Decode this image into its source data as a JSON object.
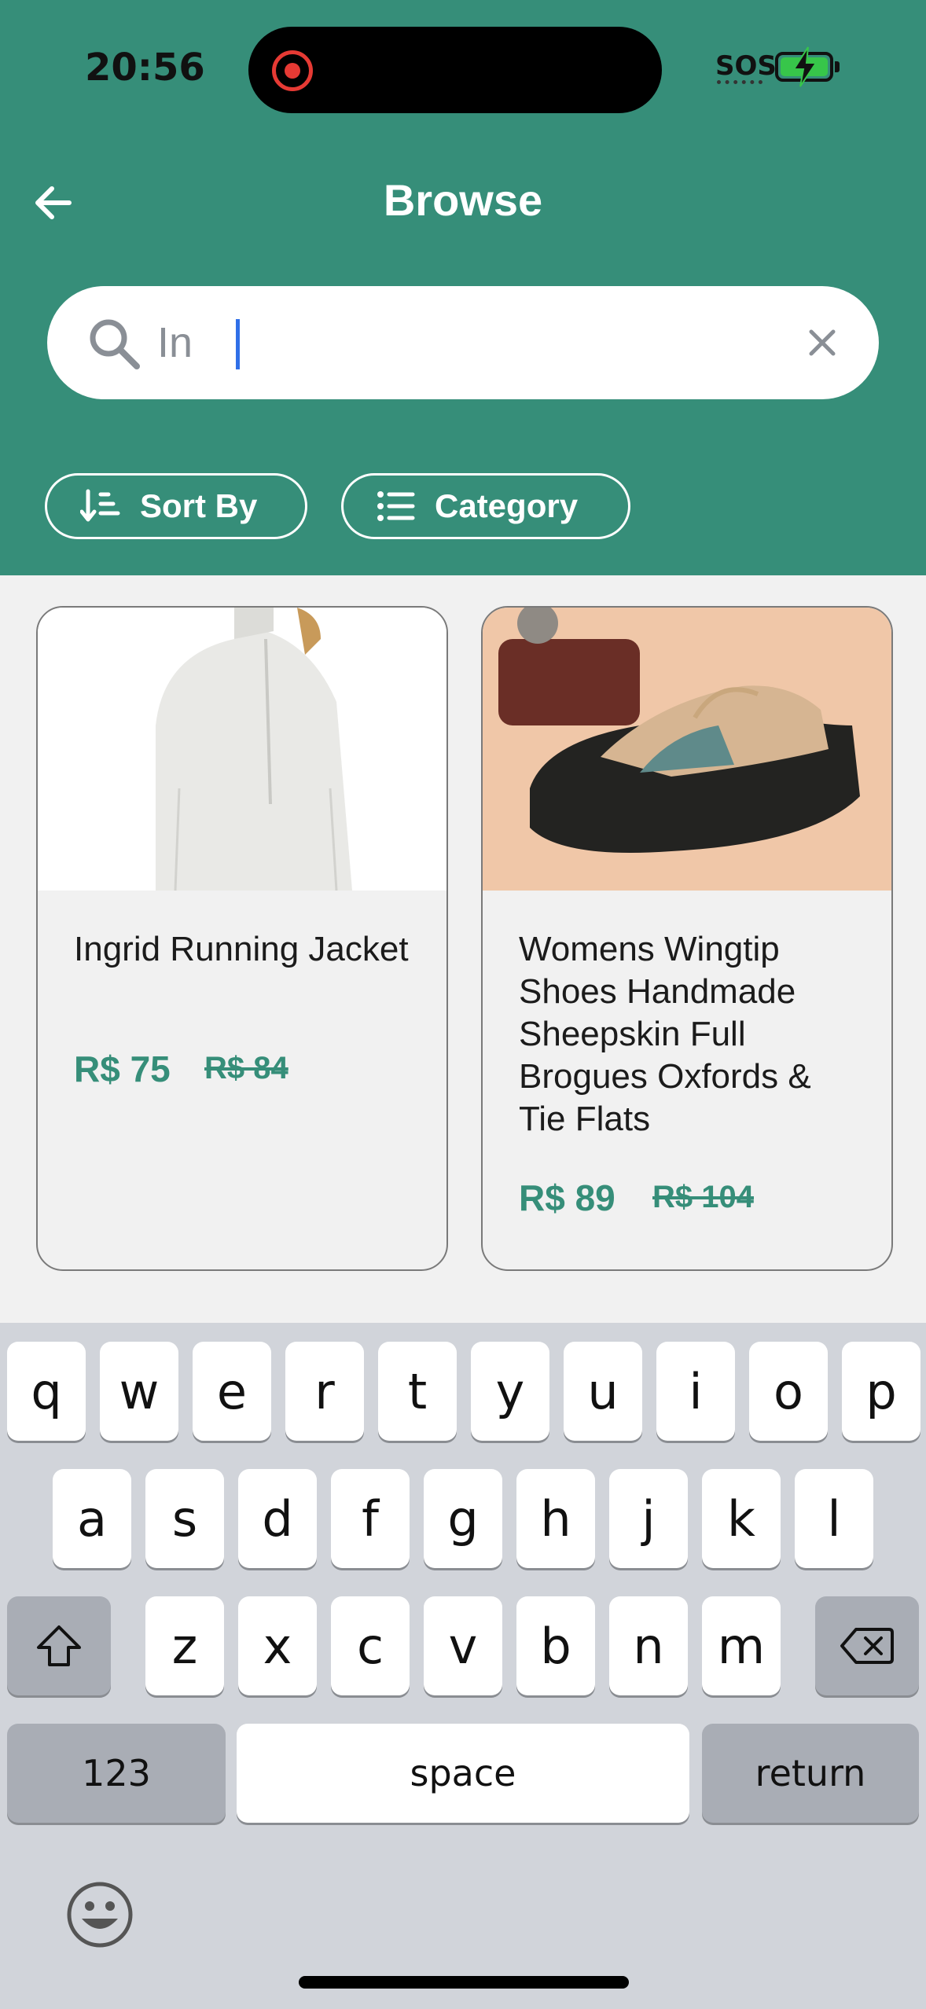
{
  "status_bar": {
    "time": "20:56",
    "sos": "SOS"
  },
  "header": {
    "title": "Browse"
  },
  "search": {
    "value": "In"
  },
  "filters": {
    "sort_label": "Sort By",
    "category_label": "Category"
  },
  "products": [
    {
      "name": "Ingrid Running Jacket",
      "price": "R$ 75",
      "old_price": "R$ 84"
    },
    {
      "name": "Womens Wingtip Shoes Handmade Sheepskin Full Brogues Oxfords & Tie Flats",
      "price": "R$ 89",
      "old_price": "R$ 104"
    }
  ],
  "keyboard": {
    "row1": [
      "q",
      "w",
      "e",
      "r",
      "t",
      "y",
      "u",
      "i",
      "o",
      "p"
    ],
    "row2": [
      "a",
      "s",
      "d",
      "f",
      "g",
      "h",
      "j",
      "k",
      "l"
    ],
    "row3": [
      "z",
      "x",
      "c",
      "v",
      "b",
      "n",
      "m"
    ],
    "numbers_label": "123",
    "space_label": "space",
    "return_label": "return"
  },
  "colors": {
    "brand": "#368e79",
    "keyboard_bg": "#d1d4da"
  }
}
